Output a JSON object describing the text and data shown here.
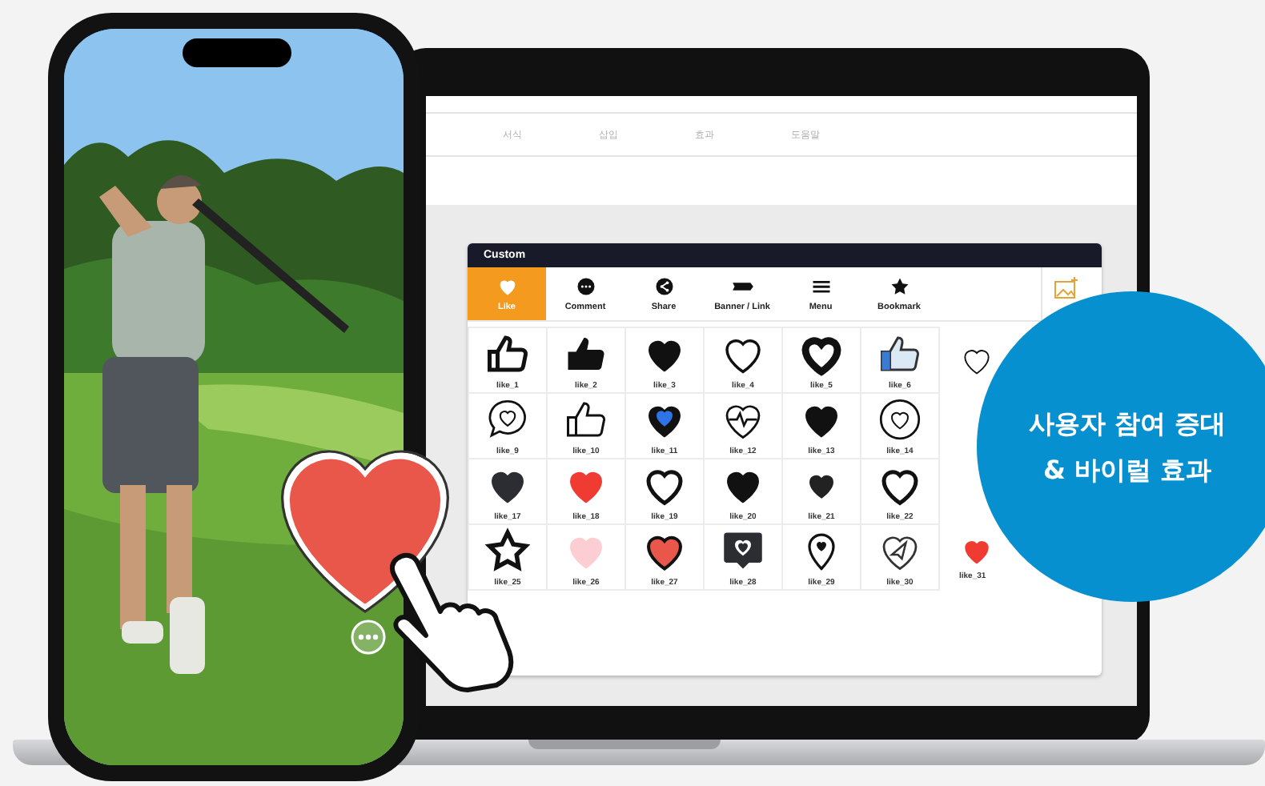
{
  "laptop": {
    "nav": [
      "서식",
      "삽입",
      "효과",
      "도움말"
    ],
    "panel": {
      "title": "Custom",
      "tabs": [
        {
          "label": "Like",
          "kind": "heart",
          "selected": true
        },
        {
          "label": "Comment",
          "kind": "comment",
          "selected": false
        },
        {
          "label": "Share",
          "kind": "share",
          "selected": false
        },
        {
          "label": "Banner / Link",
          "kind": "banner",
          "selected": false
        },
        {
          "label": "Menu",
          "kind": "menu",
          "selected": false
        },
        {
          "label": "Bookmark",
          "kind": "star",
          "selected": false
        }
      ],
      "rows": [
        [
          {
            "kind": "thumb-outline",
            "label": "like_1"
          },
          {
            "kind": "thumb-solid",
            "label": "like_2"
          },
          {
            "kind": "heart-solid",
            "label": "like_3"
          },
          {
            "kind": "heart-outline",
            "label": "like_4"
          },
          {
            "kind": "heart-thick",
            "label": "like_5"
          },
          {
            "kind": "thumb-blue",
            "label": "like_6"
          },
          {
            "kind": "heart-thin"
          }
        ],
        [
          {
            "kind": "chat-heart",
            "label": "like_9"
          },
          {
            "kind": "thumb-thin",
            "label": "like_10"
          },
          {
            "kind": "heart-blue-center",
            "label": "like_11"
          },
          {
            "kind": "heart-pulse",
            "label": "like_12"
          },
          {
            "kind": "heart-solid",
            "label": "like_13"
          },
          {
            "kind": "heart-circle",
            "label": "like_14"
          }
        ],
        [
          {
            "kind": "heart-dark",
            "label": "like_17"
          },
          {
            "kind": "heart-red",
            "label": "like_18"
          },
          {
            "kind": "heart-outline-bold",
            "label": "like_19"
          },
          {
            "kind": "heart-solid",
            "label": "like_20"
          },
          {
            "kind": "heart-small",
            "label": "like_21"
          },
          {
            "kind": "heart-outline-bold",
            "label": "like_22"
          }
        ],
        [
          {
            "kind": "star-outline",
            "label": "like_25"
          },
          {
            "kind": "heart-pink",
            "label": "like_26"
          },
          {
            "kind": "heart-red-outline",
            "label": "like_27"
          },
          {
            "kind": "heart-bubble",
            "label": "like_28"
          },
          {
            "kind": "heart-pin",
            "label": "like_29"
          },
          {
            "kind": "heart-plane",
            "label": "like_30"
          },
          {
            "kind": "heart-red",
            "label": "like_31"
          }
        ]
      ]
    }
  },
  "badge": {
    "text": "사용자 참여 증대\n& 바이럴 효과"
  }
}
